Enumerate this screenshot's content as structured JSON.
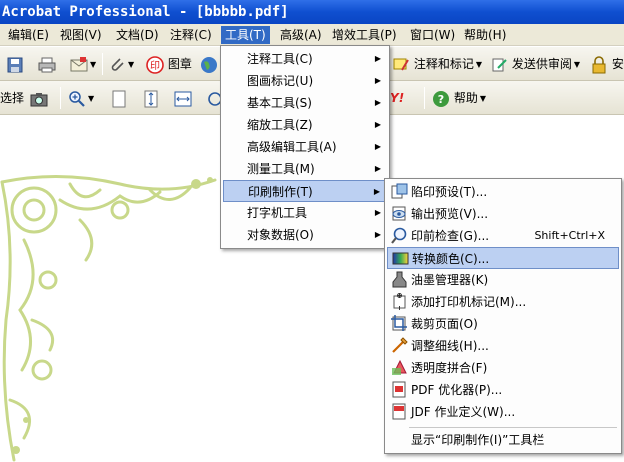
{
  "window": {
    "title": "Acrobat Professional - [bbbbb.pdf]"
  },
  "menubar": {
    "items": [
      {
        "label": "编辑(E)"
      },
      {
        "label": "视图(V)"
      },
      {
        "label": "文档(D)"
      },
      {
        "label": "注释(C)"
      },
      {
        "label": "工具(T)"
      },
      {
        "label": "高级(A)"
      },
      {
        "label": "增效工具(P)"
      },
      {
        "label": "窗口(W)"
      },
      {
        "label": "帮助(H)"
      }
    ]
  },
  "toolbar1": {
    "stamp_label": "图章",
    "comment_markup_label": "注释和标记",
    "send_review_label": "发送供审阅",
    "security_label": "安全"
  },
  "toolbar2": {
    "select_label": "选择",
    "help_label": "帮助"
  },
  "tools_menu": {
    "items": [
      {
        "label": "注释工具(C)"
      },
      {
        "label": "图画标记(U)"
      },
      {
        "label": "基本工具(S)"
      },
      {
        "label": "缩放工具(Z)"
      },
      {
        "label": "高级编辑工具(A)"
      },
      {
        "label": "测量工具(M)"
      },
      {
        "label": "印刷制作(T)"
      },
      {
        "label": "打字机工具"
      },
      {
        "label": "对象数据(O)"
      }
    ]
  },
  "print_production_menu": {
    "items": [
      {
        "label": "陷印预设(T)...",
        "icon": "trap-presets-icon"
      },
      {
        "label": "输出预览(V)...",
        "icon": "output-preview-icon"
      },
      {
        "label": "印前检查(G)...",
        "icon": "preflight-icon",
        "shortcut": "Shift+Ctrl+X"
      },
      {
        "label": "转换颜色(C)...",
        "icon": "convert-colors-icon"
      },
      {
        "label": "油墨管理器(K)",
        "icon": "ink-manager-icon"
      },
      {
        "label": "添加打印机标记(M)...",
        "icon": "printer-marks-icon"
      },
      {
        "label": "裁剪页面(O)",
        "icon": "crop-pages-icon"
      },
      {
        "label": "调整细线(H)...",
        "icon": "fix-hairlines-icon"
      },
      {
        "label": "透明度拼合(F)",
        "icon": "transparency-flattening-icon"
      },
      {
        "label": "PDF 优化器(P)...",
        "icon": "pdf-optimizer-icon"
      },
      {
        "label": "JDF 作业定义(W)...",
        "icon": "jdf-job-icon"
      },
      {
        "label": "显示“印刷制作(I)”工具栏"
      }
    ]
  },
  "colors": {
    "titlebar": "#0f4fd0",
    "menu_highlight": "#316ac5",
    "submenu_highlight": "#bcd0f2",
    "ornament": "#c8d88a"
  }
}
